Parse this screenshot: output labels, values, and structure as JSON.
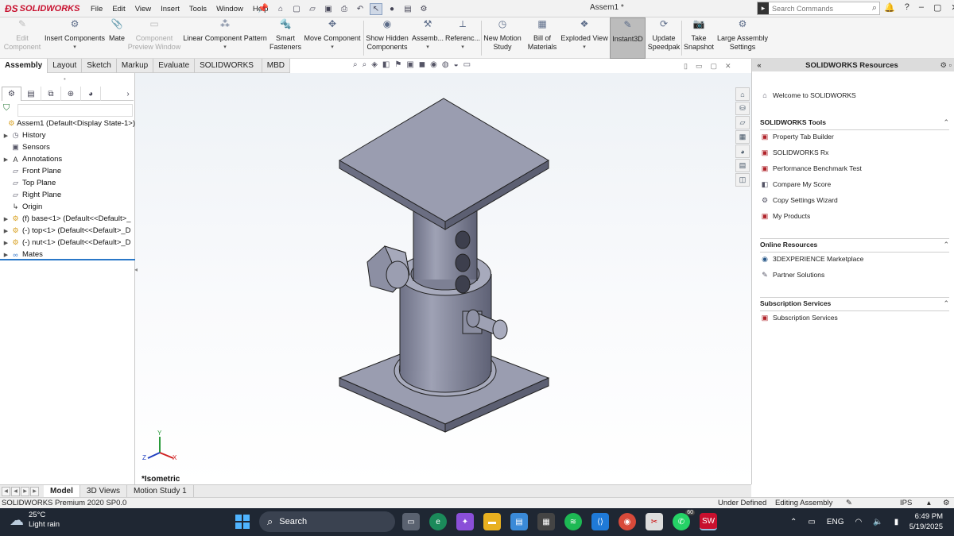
{
  "app": {
    "brand": "SOLIDWORKS",
    "document_title": "Assem1 *",
    "menus": [
      "File",
      "Edit",
      "View",
      "Insert",
      "Tools",
      "Window",
      "Help"
    ],
    "search_placeholder": "Search Commands",
    "accent_color": "#c8102e"
  },
  "toolbar": {
    "tools": [
      {
        "label": "Edit\nComponent",
        "icon": "edit-component-icon",
        "disabled": true
      },
      {
        "label": "Insert Components",
        "icon": "insert-components-icon",
        "disabled": false,
        "dropdown": true
      },
      {
        "label": "Mate",
        "icon": "mate-icon",
        "disabled": false
      },
      {
        "label": "Component\nPreview Window",
        "icon": "component-preview-icon",
        "disabled": true
      },
      {
        "label": "Linear Component Pattern",
        "icon": "linear-pattern-icon",
        "disabled": false,
        "dropdown": true
      },
      {
        "label": "Smart\nFasteners",
        "icon": "smart-fasteners-icon",
        "disabled": false
      },
      {
        "label": "Move Component",
        "icon": "move-component-icon",
        "disabled": false,
        "dropdown": true
      },
      {
        "label": "Show Hidden\nComponents",
        "icon": "show-hidden-icon",
        "disabled": false
      },
      {
        "label": "Assemb...",
        "icon": "assembly-features-icon",
        "disabled": false,
        "dropdown": true
      },
      {
        "label": "Referenc...",
        "icon": "reference-geometry-icon",
        "disabled": false,
        "dropdown": true
      },
      {
        "label": "New Motion\nStudy",
        "icon": "new-motion-study-icon",
        "disabled": false
      },
      {
        "label": "Bill of\nMaterials",
        "icon": "bill-of-materials-icon",
        "disabled": false
      },
      {
        "label": "Exploded View",
        "icon": "exploded-view-icon",
        "disabled": false,
        "dropdown": true
      },
      {
        "label": "Instant3D",
        "icon": "instant3d-icon",
        "disabled": false,
        "active": true
      },
      {
        "label": "Update\nSpeedpak",
        "icon": "update-speedpak-icon",
        "disabled": false
      },
      {
        "label": "Take\nSnapshot",
        "icon": "take-snapshot-icon",
        "disabled": false
      },
      {
        "label": "Large Assembly\nSettings",
        "icon": "large-assembly-icon",
        "disabled": false
      }
    ]
  },
  "cm_tabs": [
    "Assembly",
    "Layout",
    "Sketch",
    "Markup",
    "Evaluate",
    "SOLIDWORKS Add-Ins",
    "MBD"
  ],
  "cm_tab_active": "Assembly",
  "feature_tree": [
    {
      "label": "Assem1  (Default<Display State-1>)",
      "icon": "assembly-icon",
      "arrow": ""
    },
    {
      "label": "History",
      "icon": "history-icon",
      "arrow": "▶"
    },
    {
      "label": "Sensors",
      "icon": "sensors-icon",
      "arrow": ""
    },
    {
      "label": "Annotations",
      "icon": "annotations-icon",
      "arrow": "▶"
    },
    {
      "label": "Front Plane",
      "icon": "plane-icon",
      "arrow": ""
    },
    {
      "label": "Top Plane",
      "icon": "plane-icon",
      "arrow": ""
    },
    {
      "label": "Right Plane",
      "icon": "plane-icon",
      "arrow": ""
    },
    {
      "label": "Origin",
      "icon": "origin-icon",
      "arrow": ""
    },
    {
      "label": "(f) base<1> (Default<<Default>_",
      "icon": "part-icon",
      "arrow": "▶"
    },
    {
      "label": "(-) top<1> (Default<<Default>_D",
      "icon": "part-icon",
      "arrow": "▶"
    },
    {
      "label": "(-) nut<1> (Default<<Default>_D",
      "icon": "part-icon",
      "arrow": "▶"
    },
    {
      "label": "Mates",
      "icon": "mates-icon",
      "arrow": "▶"
    }
  ],
  "viewport": {
    "view_name": "*Isometric",
    "model_color": "#8c8fa3"
  },
  "resources": {
    "title": "SOLIDWORKS Resources",
    "welcome": "Welcome to SOLIDWORKS",
    "sections": [
      {
        "title": "SOLIDWORKS Tools",
        "items": [
          "Property Tab Builder",
          "SOLIDWORKS Rx",
          "Performance Benchmark Test",
          "Compare My Score",
          "Copy Settings Wizard",
          "My Products"
        ]
      },
      {
        "title": "Online Resources",
        "items": [
          "3DEXPERIENCE Marketplace",
          "Partner Solutions"
        ]
      },
      {
        "title": "Subscription Services",
        "items": [
          "Subscription Services"
        ]
      }
    ]
  },
  "bottom_tabs": [
    "Model",
    "3D Views",
    "Motion Study 1"
  ],
  "bottom_tab_active": "Model",
  "status": {
    "product": "SOLIDWORKS Premium 2020 SP0.0",
    "state": "Under Defined",
    "mode": "Editing Assembly",
    "units": "IPS"
  },
  "taskbar": {
    "temperature": "25°C",
    "weather": "Light rain",
    "search_label": "Search",
    "language": "ENG",
    "time": "6:49 PM",
    "date": "5/19/2025",
    "whatsapp_badge": "60"
  }
}
